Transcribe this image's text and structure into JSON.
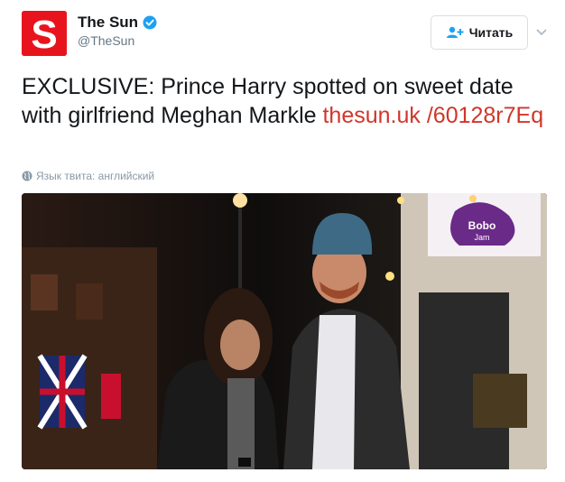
{
  "account": {
    "display_name": "The Sun",
    "handle": "@TheSun",
    "avatar_letter": "S",
    "verified_icon": "verified-badge-icon",
    "brand_color": "#e8141d"
  },
  "follow": {
    "label": "Читать",
    "icon": "add-user-icon"
  },
  "tweet": {
    "text": "EXCLUSIVE: Prince Harry spotted on sweet date with girlfriend Meghan Markle ",
    "link_text": "thesun.uk /60128r7Eq",
    "link_color": "#d0362b"
  },
  "language": {
    "text": "Язык твита: английский",
    "icon": "globe-icon"
  },
  "photo": {
    "shop_sign": "Bobo\nJam"
  }
}
